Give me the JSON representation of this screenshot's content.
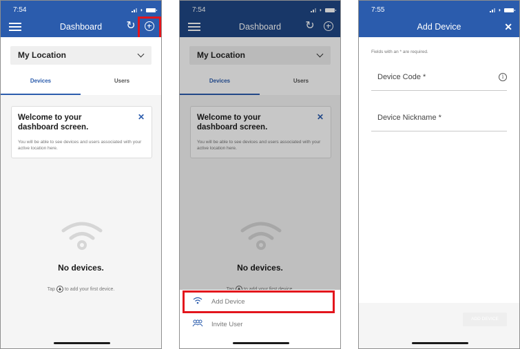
{
  "screens": [
    {
      "status_time": "7:54",
      "title": "Dashboard",
      "location": "My Location",
      "tabs": [
        {
          "label": "Devices",
          "active": true
        },
        {
          "label": "Users",
          "active": false
        }
      ],
      "welcome": {
        "title": "Welcome to your dashboard screen.",
        "text": "You will be able to see devices and users associated with your active location here."
      },
      "empty_title": "No devices.",
      "empty_hint_pre": "Tap",
      "empty_hint_post": "to add your first device.",
      "highlight": "add-button"
    },
    {
      "status_time": "7:54",
      "title": "Dashboard",
      "location": "My Location",
      "tabs": [
        {
          "label": "Devices",
          "active": true
        },
        {
          "label": "Users",
          "active": false
        }
      ],
      "welcome": {
        "title": "Welcome to your dashboard screen.",
        "text": "You will be able to see devices and users associated with your active location here."
      },
      "empty_title": "No devices.",
      "empty_hint_pre": "Tap",
      "empty_hint_post": "to add your first device.",
      "sheet_items": [
        {
          "icon": "wifi-icon",
          "label": "Add Device"
        },
        {
          "icon": "users-icon",
          "label": "Invite User"
        }
      ],
      "highlight": "Add Device"
    },
    {
      "status_time": "7:55",
      "title": "Add Device",
      "required_note": "Fields with an * are required.",
      "fields": [
        {
          "label": "Device Code *",
          "value": ""
        },
        {
          "label": "Device Nickname *",
          "value": ""
        }
      ],
      "submit_label": "ADD DEVICE"
    }
  ],
  "colors": {
    "primary": "#2b5cad",
    "highlight": "#e3151c"
  }
}
